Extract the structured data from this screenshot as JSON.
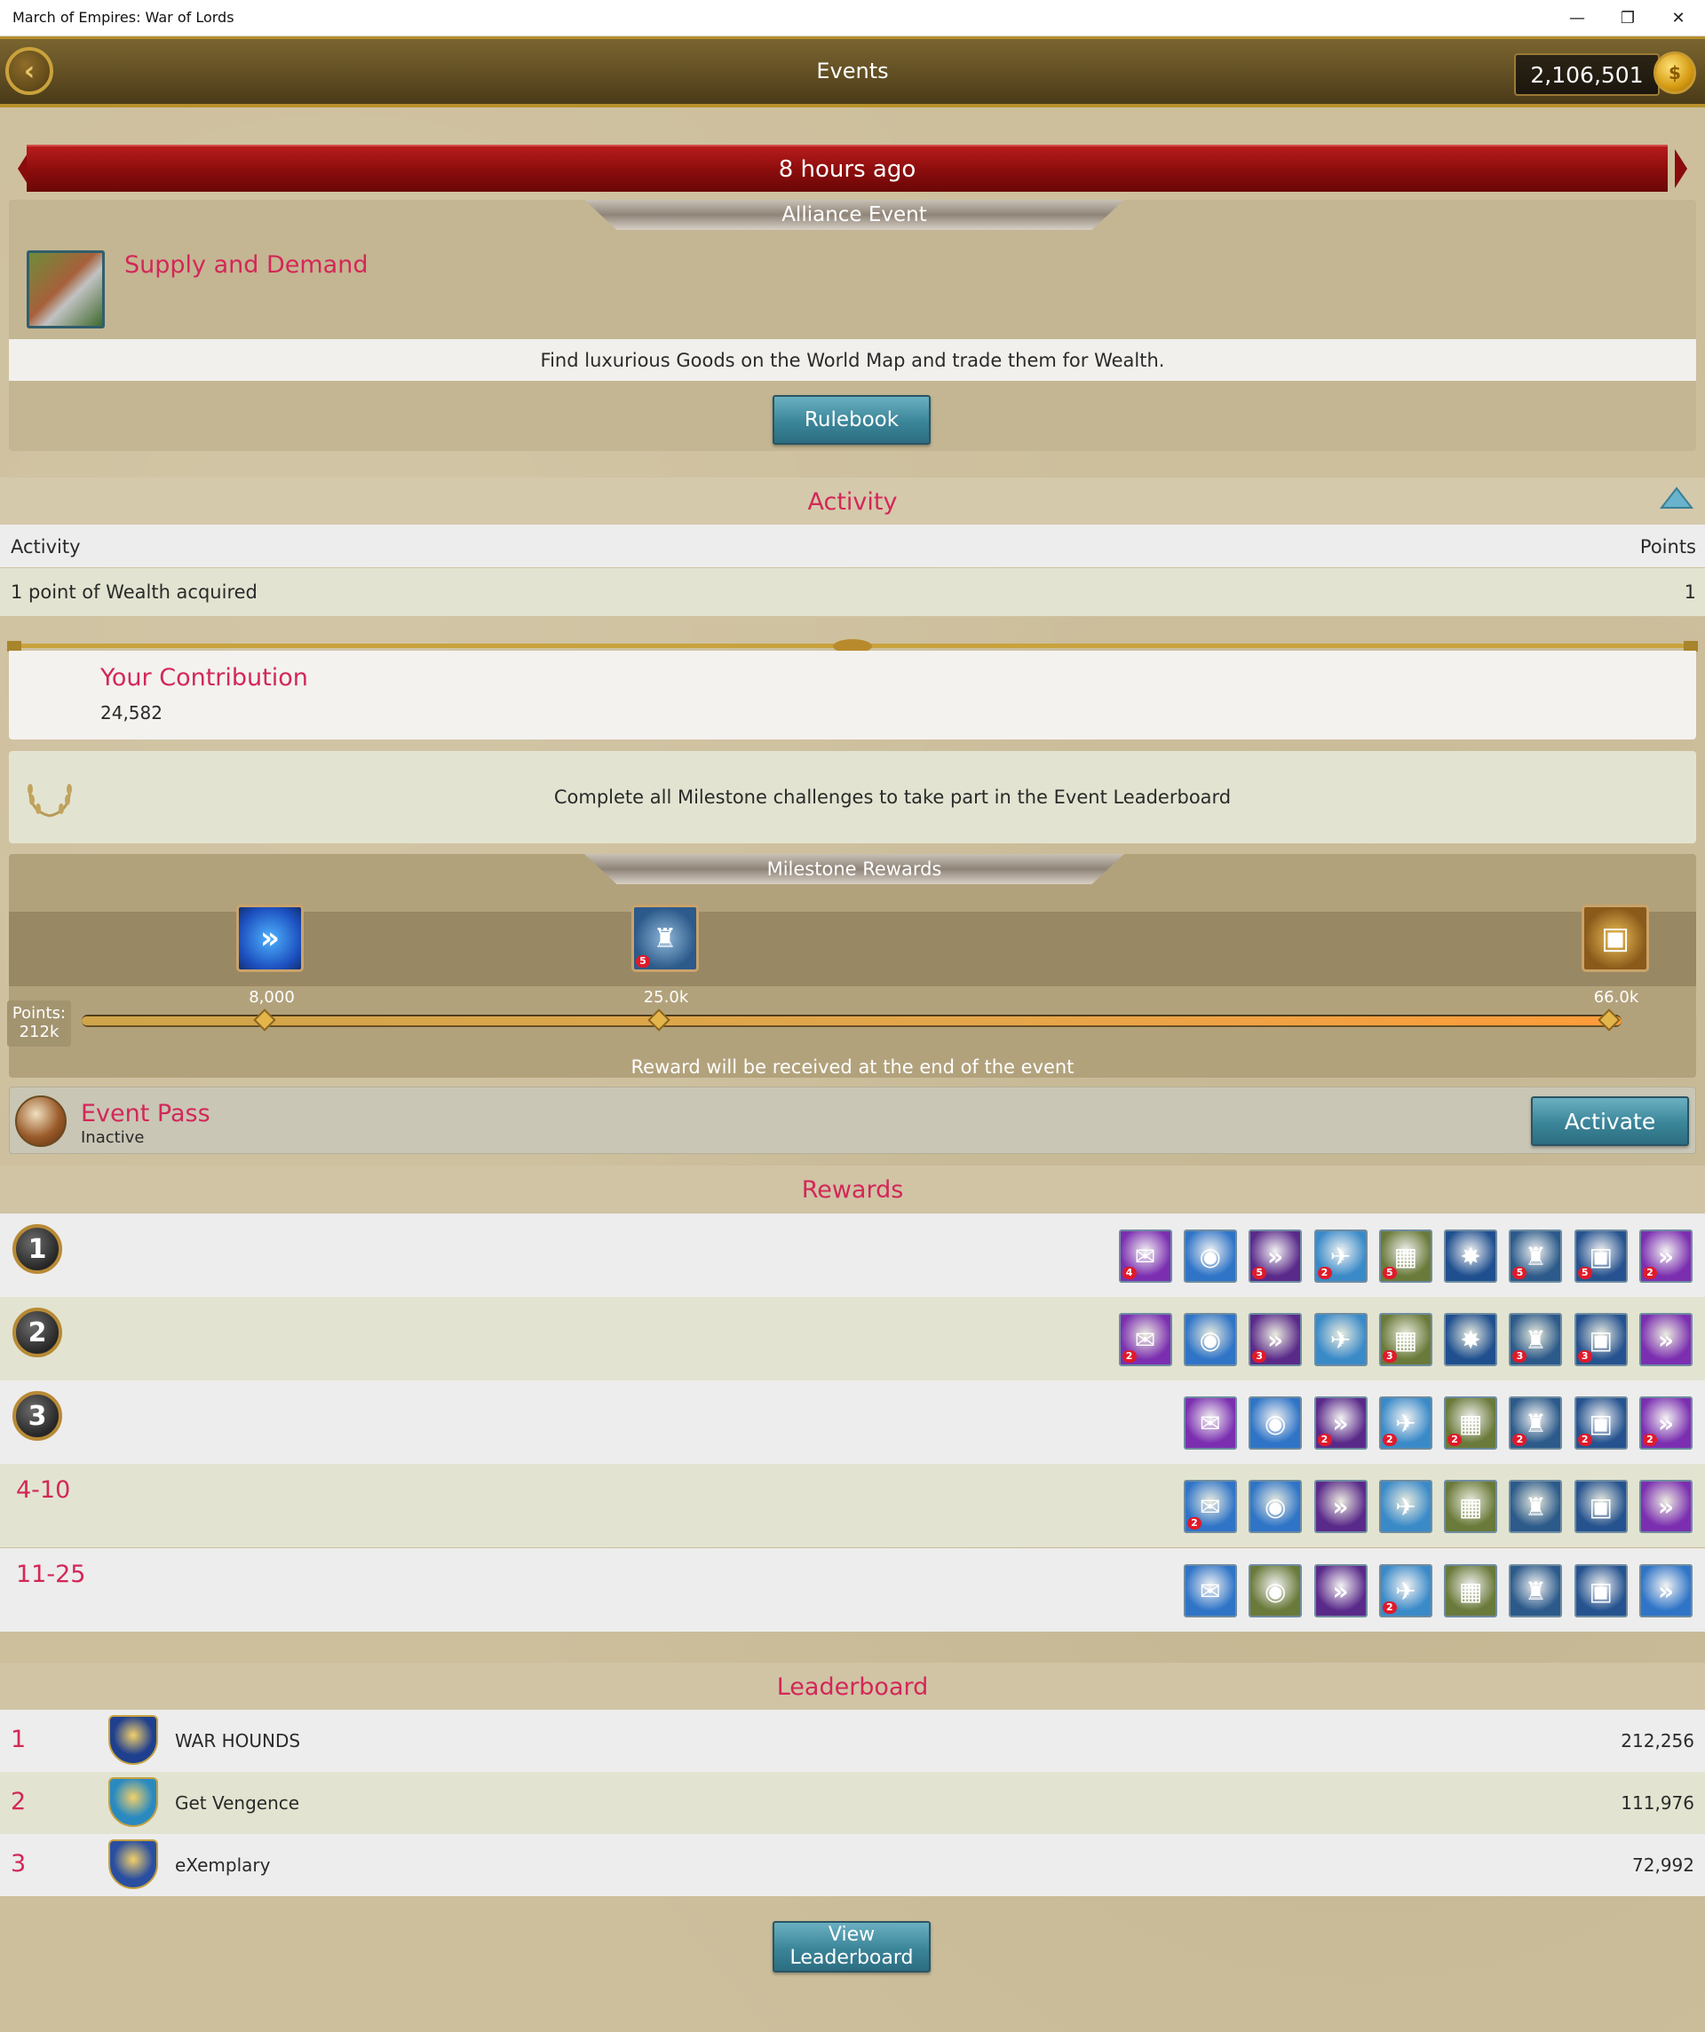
{
  "window": {
    "title": "March of Empires: War of Lords",
    "minimize": "—",
    "restore": "❐",
    "close": "✕"
  },
  "header": {
    "title": "Events",
    "currency_amount": "2,106,501"
  },
  "banner": {
    "text": "8 hours ago"
  },
  "event": {
    "category": "Alliance Event",
    "name": "Supply and Demand",
    "description": "Find luxurious Goods on the World Map and trade them for Wealth.",
    "rulebook_label": "Rulebook"
  },
  "activity": {
    "heading": "Activity",
    "col_activity": "Activity",
    "col_points": "Points",
    "rows": [
      {
        "activity": "1 point of Wealth acquired",
        "points": "1"
      }
    ]
  },
  "contribution": {
    "title": "Your Contribution",
    "value": "24,582"
  },
  "milestone_note": "Complete all Milestone challenges to take part in the Event Leaderboard",
  "milestones": {
    "title": "Milestone Rewards",
    "points_label": "Points:",
    "points_value": "212k",
    "progress_fraction": 1.0,
    "items": [
      {
        "label": "8,000",
        "icon": "speedup-icon"
      },
      {
        "label": "25.0k",
        "icon": "castle-icon",
        "count": "5"
      },
      {
        "label": "66.0k",
        "icon": "treasure-chest-icon"
      }
    ],
    "note": "Reward will be received at the end of the event"
  },
  "event_pass": {
    "title": "Event Pass",
    "status": "Inactive",
    "activate_label": "Activate"
  },
  "rewards": {
    "heading": "Rewards",
    "rows": [
      {
        "rank": "1",
        "items": [
          {
            "icon": "scroll-icon",
            "count": "4",
            "color": "#7b2fb0"
          },
          {
            "icon": "gold-coins-icon",
            "count": "",
            "color": "#2f74c7"
          },
          {
            "icon": "troop-speedup-icon",
            "count": "5",
            "color": "#5a2a8a"
          },
          {
            "icon": "dove-icon",
            "count": "2",
            "color": "#3a8ac8"
          },
          {
            "icon": "resource-crate-icon",
            "count": "5",
            "color": "#6a7a3a"
          },
          {
            "icon": "explosive-chest-icon",
            "count": "",
            "color": "#1f4f8f"
          },
          {
            "icon": "castle-icon",
            "count": "5",
            "color": "#2c5a8a"
          },
          {
            "icon": "treasure-chest-icon",
            "count": "5",
            "color": "#26538f"
          },
          {
            "icon": "speedup-icon",
            "count": "2",
            "color": "#7b2fb0"
          }
        ]
      },
      {
        "rank": "2",
        "items": [
          {
            "icon": "scroll-icon",
            "count": "2",
            "color": "#7b2fb0"
          },
          {
            "icon": "gold-coins-icon",
            "count": "",
            "color": "#2f74c7"
          },
          {
            "icon": "troop-speedup-icon",
            "count": "3",
            "color": "#5a2a8a"
          },
          {
            "icon": "dove-icon",
            "count": "",
            "color": "#3a8ac8"
          },
          {
            "icon": "resource-crate-icon",
            "count": "3",
            "color": "#6a7a3a"
          },
          {
            "icon": "explosive-chest-icon",
            "count": "",
            "color": "#1f4f8f"
          },
          {
            "icon": "castle-icon",
            "count": "3",
            "color": "#2c5a8a"
          },
          {
            "icon": "treasure-chest-icon",
            "count": "3",
            "color": "#26538f"
          },
          {
            "icon": "speedup-icon",
            "count": "",
            "color": "#7b2fb0"
          }
        ]
      },
      {
        "rank": "3",
        "items": [
          {
            "icon": "scroll-icon",
            "count": "",
            "color": "#7b2fb0"
          },
          {
            "icon": "gold-coins-icon",
            "count": "",
            "color": "#2f74c7"
          },
          {
            "icon": "troop-speedup-icon",
            "count": "2",
            "color": "#5a2a8a"
          },
          {
            "icon": "dove-icon",
            "count": "2",
            "color": "#3a8ac8"
          },
          {
            "icon": "resource-crate-icon",
            "count": "2",
            "color": "#6a7a3a"
          },
          {
            "icon": "castle-icon",
            "count": "2",
            "color": "#2c5a8a"
          },
          {
            "icon": "treasure-chest-icon",
            "count": "2",
            "color": "#26538f"
          },
          {
            "icon": "speedup-icon",
            "count": "2",
            "color": "#7b2fb0"
          }
        ]
      },
      {
        "rank": "4-10",
        "items": [
          {
            "icon": "scroll-icon",
            "count": "2",
            "color": "#2f74c7"
          },
          {
            "icon": "gold-coins-icon",
            "count": "",
            "color": "#2f74c7"
          },
          {
            "icon": "troop-speedup-icon",
            "count": "",
            "color": "#5a2a8a"
          },
          {
            "icon": "dove-icon",
            "count": "",
            "color": "#3a8ac8"
          },
          {
            "icon": "resource-crate-icon",
            "count": "",
            "color": "#6a7a3a"
          },
          {
            "icon": "castle-icon",
            "count": "",
            "color": "#2c5a8a"
          },
          {
            "icon": "treasure-chest-icon",
            "count": "",
            "color": "#26538f"
          },
          {
            "icon": "speedup-icon",
            "count": "",
            "color": "#7b2fb0"
          }
        ]
      },
      {
        "rank": "11-25",
        "items": [
          {
            "icon": "scroll-icon",
            "count": "",
            "color": "#2f74c7"
          },
          {
            "icon": "gold-coins-icon",
            "count": "",
            "color": "#6a7a3a"
          },
          {
            "icon": "troop-speedup-icon",
            "count": "",
            "color": "#5a2a8a"
          },
          {
            "icon": "dove-icon",
            "count": "2",
            "color": "#3a8ac8"
          },
          {
            "icon": "resource-crate-icon",
            "count": "",
            "color": "#6a7a3a"
          },
          {
            "icon": "castle-icon",
            "count": "",
            "color": "#2c5a8a"
          },
          {
            "icon": "treasure-chest-icon",
            "count": "",
            "color": "#26538f"
          },
          {
            "icon": "speedup-icon",
            "count": "",
            "color": "#2f74c7"
          }
        ]
      }
    ]
  },
  "leaderboard": {
    "heading": "Leaderboard",
    "rows": [
      {
        "rank": "1",
        "name": "WAR HOUNDS",
        "score": "212,256",
        "crest_color": "#1f3f8f"
      },
      {
        "rank": "2",
        "name": "Get Vengence",
        "score": "111,976",
        "crest_color": "#2a8ac0"
      },
      {
        "rank": "3",
        "name": "eXemplary",
        "score": "72,992",
        "crest_color": "#2a4fa0"
      }
    ],
    "view_label": "View\nLeaderboard"
  },
  "colors": {
    "accent_text": "#d32758",
    "button_blue": "#3b8599",
    "banner_red": "#8a0c0c",
    "gold": "#c9a23c"
  }
}
